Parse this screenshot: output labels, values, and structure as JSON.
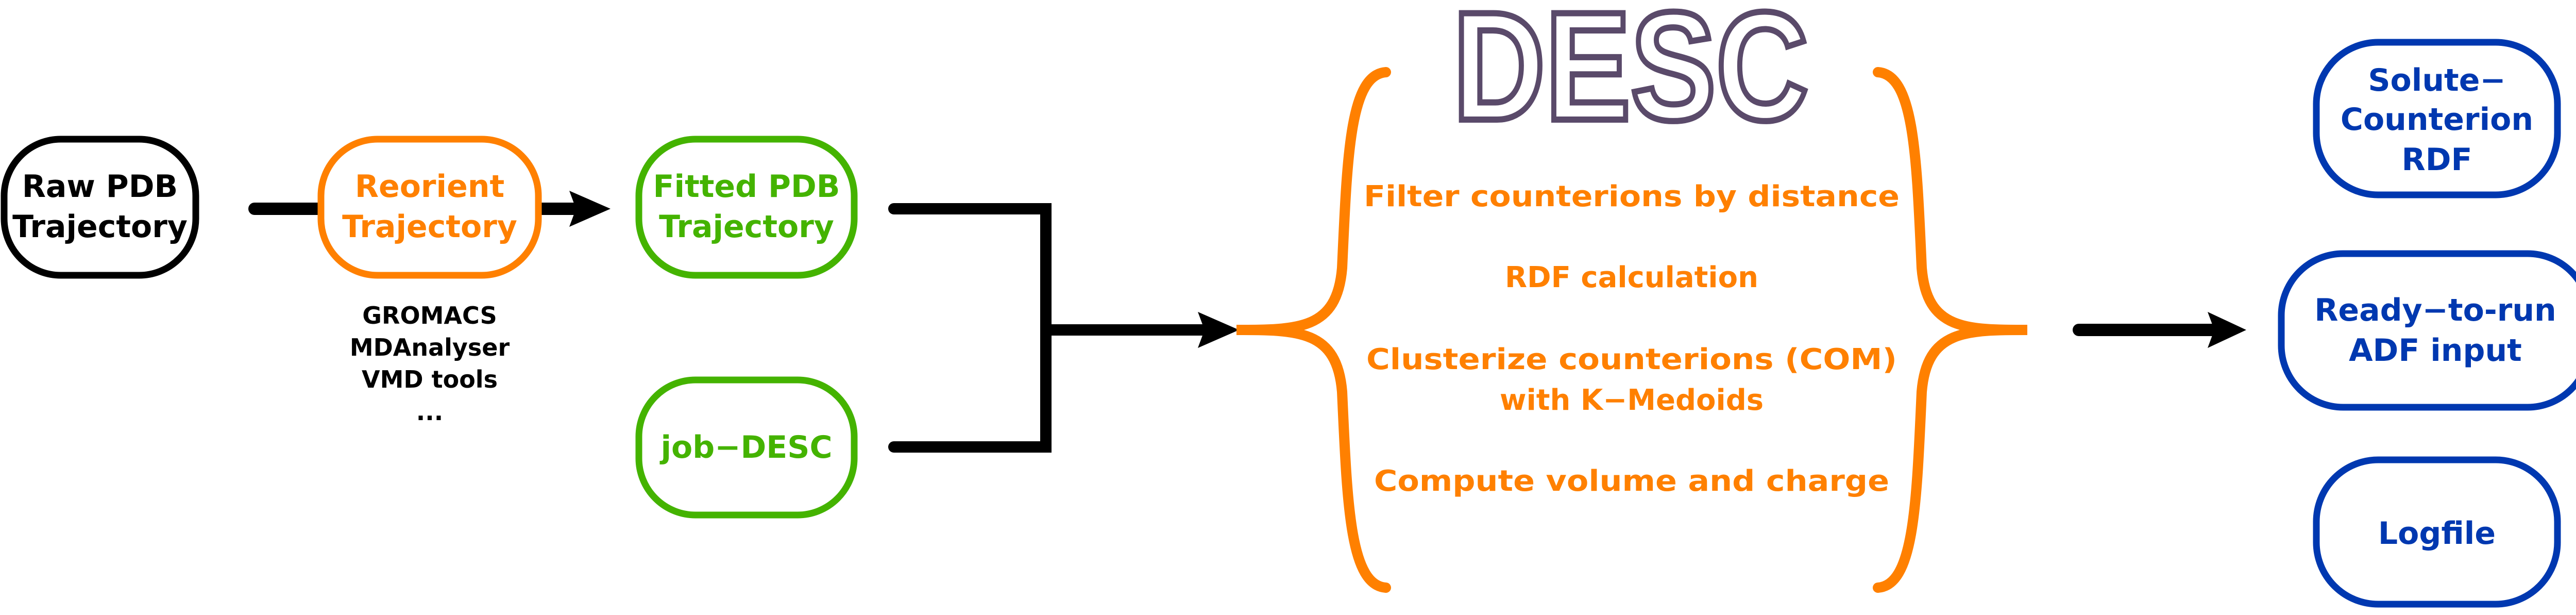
{
  "colors": {
    "input": "#000000",
    "preprocess": "#ff8000",
    "desc_input": "#44b300",
    "desc_step": "#ff8000",
    "output": "#0038b0",
    "logo": "#5a4a6a"
  },
  "nodes": {
    "raw": [
      "Raw PDB",
      "Trajectory"
    ],
    "reorient": [
      "Reorient",
      "Trajectory"
    ],
    "fitted": [
      "Fitted PDB",
      "Trajectory"
    ],
    "job": [
      "job−DESC"
    ],
    "rdf_out": [
      "Solute−",
      "Counterion",
      "RDF"
    ],
    "adf_out": [
      "Ready−to-run",
      "ADF input"
    ],
    "log_out": [
      "Logfile"
    ]
  },
  "tools": [
    "GROMACS",
    "MDAnalyser",
    "VMD tools",
    "..."
  ],
  "desc": {
    "logo": "DESC",
    "steps": [
      "Filter counterions by distance",
      "RDF calculation",
      "Clusterize counterions (COM)",
      "with K−Medoids",
      "Compute volume and charge"
    ]
  }
}
